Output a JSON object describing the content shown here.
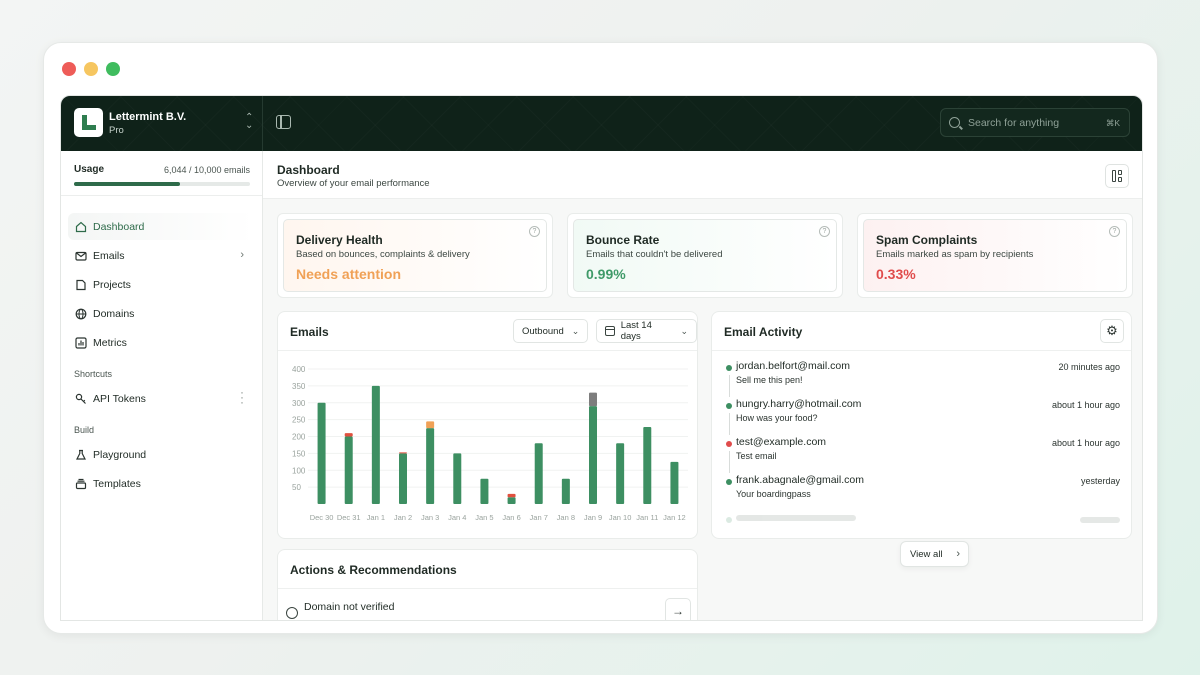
{
  "org": {
    "name": "Lettermint B.V.",
    "plan": "Pro"
  },
  "search": {
    "placeholder": "Search for anything",
    "shortcut": "⌘K"
  },
  "usage": {
    "label": "Usage",
    "value": "6,044 / 10,000 emails",
    "fraction": 0.6044
  },
  "nav": {
    "items": [
      {
        "label": "Dashboard",
        "icon": "home-icon",
        "active": true
      },
      {
        "label": "Emails",
        "icon": "mail-icon",
        "has_submenu": true
      },
      {
        "label": "Projects",
        "icon": "folder-icon"
      },
      {
        "label": "Domains",
        "icon": "globe-icon"
      },
      {
        "label": "Metrics",
        "icon": "chart-icon"
      }
    ],
    "shortcuts_label": "Shortcuts",
    "shortcuts": [
      {
        "label": "API Tokens",
        "icon": "key-icon"
      }
    ],
    "build_label": "Build",
    "build": [
      {
        "label": "Playground",
        "icon": "flask-icon"
      },
      {
        "label": "Templates",
        "icon": "stack-icon"
      }
    ]
  },
  "header": {
    "title": "Dashboard",
    "subtitle": "Overview of your email performance"
  },
  "stats": [
    {
      "title": "Delivery Health",
      "desc": "Based on bounces, complaints & delivery",
      "value": "Needs attention",
      "color": "#f0a156",
      "tint": "#fff6ef"
    },
    {
      "title": "Bounce Rate",
      "desc": "Emails that couldn't be delivered",
      "value": "0.99%",
      "color": "#3f9a68",
      "tint": "#f1faf5"
    },
    {
      "title": "Spam Complaints",
      "desc": "Emails marked as spam by recipients",
      "value": "0.33%",
      "color": "#e04c4c",
      "tint": "#fdf1f1"
    }
  ],
  "emails_card": {
    "title": "Emails",
    "direction": "Outbound",
    "range": "Last 14 days"
  },
  "chart_data": {
    "type": "bar",
    "stacked": true,
    "categories": [
      "Dec 30",
      "Dec 31",
      "Jan 1",
      "Jan 2",
      "Jan 3",
      "Jan 4",
      "Jan 5",
      "Jan 6",
      "Jan 7",
      "Jan 8",
      "Jan 9",
      "Jan 10",
      "Jan 11",
      "Jan 12"
    ],
    "yticks": [
      50,
      100,
      150,
      200,
      250,
      300,
      350,
      400
    ],
    "ylim": [
      0,
      400
    ],
    "series": [
      {
        "color": "#3d8f62",
        "values": [
          300,
          200,
          350,
          150,
          225,
          150,
          75,
          20,
          180,
          75,
          290,
          180,
          228,
          125
        ]
      },
      {
        "color": "#e0503f",
        "values": [
          0,
          10,
          0,
          3,
          0,
          0,
          0,
          10,
          0,
          0,
          0,
          0,
          0,
          0
        ]
      },
      {
        "color": "#f0a156",
        "values": [
          0,
          0,
          0,
          0,
          20,
          0,
          0,
          0,
          0,
          0,
          0,
          0,
          0,
          0
        ]
      },
      {
        "color": "#7d7d7d",
        "values": [
          0,
          0,
          0,
          0,
          0,
          0,
          0,
          0,
          0,
          0,
          40,
          0,
          0,
          0
        ]
      }
    ]
  },
  "activity": {
    "title": "Email Activity",
    "items": [
      {
        "email": "jordan.belfort@mail.com",
        "subject": "Sell me this pen!",
        "time": "20 minutes ago",
        "status_color": "#3d8f62"
      },
      {
        "email": "hungry.harry@hotmail.com",
        "subject": "How was your food?",
        "time": "about 1 hour ago",
        "status_color": "#3d8f62"
      },
      {
        "email": "test@example.com",
        "subject": "Test email",
        "time": "about 1 hour ago",
        "status_color": "#e04c4c"
      },
      {
        "email": "frank.abagnale@gmail.com",
        "subject": "Your boardingpass",
        "time": "yesterday",
        "status_color": "#3d8f62"
      }
    ],
    "view_all": "View all"
  },
  "actions": {
    "title": "Actions & Recommendations",
    "items": [
      {
        "text": "Domain not verified",
        "icon": "globe-icon"
      }
    ]
  },
  "colors": {
    "brand": "#0f2219",
    "accent": "#2e6b4a"
  }
}
